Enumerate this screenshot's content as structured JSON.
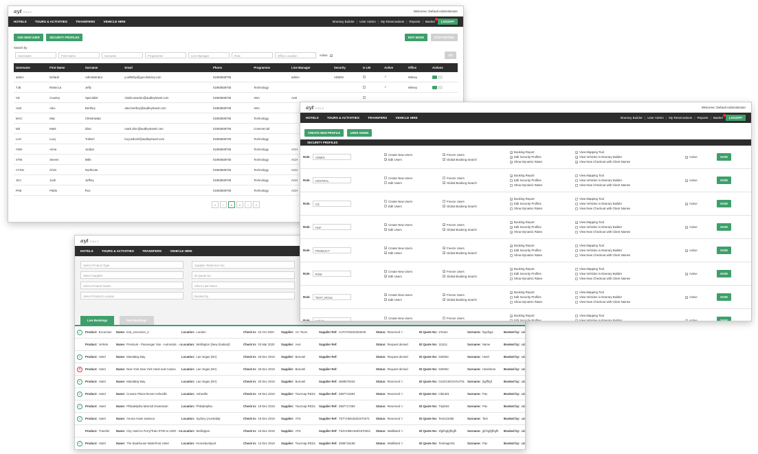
{
  "brand": {
    "logo": "ayt",
    "suffix": "GOLF"
  },
  "welcome": "Welcome: Default Administrator",
  "nav": {
    "left": [
      "HOTELS",
      "TOURS & ACTIVITIES",
      "TRANSFERS",
      "VEHICLE HIRE"
    ],
    "right": [
      "Itinerary Builder",
      "User Admin",
      "My Reservations",
      "Reports",
      "Basket"
    ],
    "logout": "LOGOFF"
  },
  "user_admin": {
    "buttons": {
      "add": "ADD NEW USER",
      "profiles": "SECURITY PROFILES",
      "edit": "EDIT MODE",
      "stop": "STOP EDITING"
    },
    "search_label": "Search by",
    "placeholders": [
      "Username",
      "First Name",
      "Surname",
      "Programme",
      "Line Manager",
      "Role",
      "Office Location"
    ],
    "active_label": "Active",
    "go": "GO",
    "columns": [
      "Username",
      "First Name",
      "Surname",
      "Email",
      "Phone",
      "Programme",
      "Line Manager",
      "Security",
      "Is LM",
      "Active",
      "Office",
      "Actions"
    ],
    "rows": [
      [
        "admin",
        "Default",
        "Administrator",
        "p.wilhitby@gocuhdsnry.com",
        "01993838705",
        "",
        "admin",
        "ADMIN",
        "",
        "✓",
        "Witney"
      ],
      [
        "TJE",
        "Rebecca",
        "Jeffy",
        "",
        "01993838705",
        "Technology",
        "",
        "",
        "",
        "✓",
        "Witney"
      ],
      [
        "CE",
        "Country",
        "Specialist",
        "claink.weedon@audleytravel.com",
        "01993838705",
        "ANA",
        "ALB",
        "",
        "",
        "",
        ""
      ],
      [
        "ALB",
        "Alex",
        "Berthey",
        "alex.berthey@audleytravel.com",
        "01993838705",
        "ANA",
        "",
        "",
        "",
        "",
        ""
      ],
      [
        "MAC",
        "Mac",
        "Chhetriwala",
        "",
        "01993838705",
        "Technology",
        "",
        "",
        "",
        "",
        ""
      ],
      [
        "MZ",
        "Mark",
        "Zilec",
        "mark.zilec@audleytravel.com",
        "01993838705",
        "Commercial",
        "",
        "",
        "",
        "",
        ""
      ],
      [
        "LUC",
        "Lucy",
        "Tulloch",
        "lucy.tulloch@audleytravel.com",
        "01993838705",
        "Technology",
        "",
        "",
        "",
        "",
        ""
      ],
      [
        "ANN",
        "Anna",
        "Jordan",
        "",
        "01993838705",
        "Technology",
        "ACH",
        "",
        "",
        "",
        ""
      ],
      [
        "STM",
        "Steven",
        "Mills",
        "",
        "01993838705",
        "Technology",
        "ACH",
        "",
        "",
        "",
        ""
      ],
      [
        "CTSN",
        "Chris",
        "Northcote",
        "",
        "01993838705",
        "Technology",
        "ACH",
        "",
        "",
        "",
        ""
      ],
      [
        "JOJ",
        "Josh",
        "Jeffrey",
        "",
        "01993838705",
        "Technology",
        "ACH",
        "",
        "",
        "",
        ""
      ],
      [
        "PAB",
        "Pablo",
        "Rox",
        "",
        "01993838705",
        "Technology",
        "ACH",
        "",
        "",
        "",
        ""
      ]
    ],
    "pages": [
      "«",
      "‹",
      "1",
      "2",
      "›",
      "»"
    ]
  },
  "security_profiles": {
    "buttons": {
      "create": "CREATE NEW PROFILE",
      "admin": "USER ADMIN"
    },
    "header": "SECURITY PROFILES",
    "role_label": "Role:",
    "save": "SAVE",
    "perm_labels": {
      "create_users": "Create New Users",
      "edit_users": "Edit Users",
      "freeze_users": "Freeze Users",
      "global_search": "Global Booking Search",
      "booking_report": "Booking Report",
      "edit_profiles": "Edit Security Profiles",
      "dynamic_rates": "Show Dynamic Rates",
      "mapping_tool": "View Mapping Tool",
      "vehicles": "View Vehicles in Itinerary Builder",
      "checkout": "View New Checkout with Client Names",
      "active": "Active"
    },
    "roles": [
      {
        "name": "ADMIN",
        "flags": [
          1,
          1,
          1,
          1,
          1,
          1,
          1,
          1,
          1,
          1,
          1
        ]
      },
      {
        "name": "CENTRAL",
        "flags": [
          0,
          0,
          0,
          1,
          1,
          0,
          0,
          0,
          0,
          0,
          1
        ]
      },
      {
        "name": "CS",
        "flags": [
          0,
          0,
          0,
          1,
          1,
          0,
          0,
          0,
          0,
          0,
          1
        ]
      },
      {
        "name": "HUF",
        "flags": [
          1,
          1,
          1,
          1,
          1,
          1,
          1,
          1,
          0,
          0,
          1
        ]
      },
      {
        "name": "PRODUCT",
        "flags": [
          1,
          1,
          1,
          1,
          1,
          0,
          0,
          0,
          0,
          0,
          1
        ]
      },
      {
        "name": "RSM",
        "flags": [
          1,
          1,
          1,
          1,
          1,
          0,
          0,
          0,
          0,
          0,
          1
        ]
      },
      {
        "name": "TEST_ROLE",
        "flags": [
          1,
          1,
          1,
          1,
          1,
          0,
          0,
          0,
          0,
          0,
          1
        ]
      },
      {
        "name": "Vehicle",
        "flags": [
          0,
          0,
          0,
          1,
          1,
          0,
          0,
          0,
          1,
          0,
          1
        ]
      }
    ]
  },
  "bookings": {
    "filters": [
      "Select Product Type",
      "Supplier Reference No",
      "Select Supplier",
      "ID Quote No",
      "Select Product Name",
      "Client Last Name",
      "Select Product Location",
      "Booked by"
    ],
    "tabs": [
      "Live Bookings",
      "Past Bookings"
    ],
    "labels": {
      "product": "Product:",
      "name": "Name:",
      "location": "Location:",
      "checkin": "Check In:",
      "supplier": "Supplier:",
      "supref": "Supplier Ref:",
      "status": "Status:",
      "idquote": "ID Quote No:",
      "surname": "Surname:",
      "bookedby": "Booked by:"
    },
    "rows": [
      {
        "state": "ok",
        "product": "Excursion",
        "name": "test_excursion_2",
        "location": "London",
        "checkin": "23 Oct 2020",
        "supplier": "AC Tours",
        "supref": "AUT2725SS/263248",
        "status": "Reserved",
        "idquote": "2Years",
        "surname": "fsgsfsgs",
        "bookedby": "admin"
      },
      {
        "state": "none",
        "product": "Vehicle",
        "name": "Premium - Passenger Van - Automatic - A/C (PVAR)",
        "location": "Wellington (New Zealand)",
        "checkin": "03 Mar 2020",
        "supplier": "Avis",
        "supref": "",
        "status": "Request denied",
        "idquote": "111111",
        "surname": "Name",
        "bookedby": "admin"
      },
      {
        "state": "ok",
        "product": "Hotel",
        "name": "Mandalay Bay",
        "location": "Las Vegas (NV)",
        "checkin": "26 Dec 2019",
        "supplier": "Bonotel",
        "supref": "",
        "status": "Request denied",
        "idquote": "529363",
        "surname": "Hotel",
        "bookedby": "admin"
      },
      {
        "state": "bad",
        "product": "Hotel",
        "name": "New York New York Hotel and Casino",
        "location": "Las Vegas (NV)",
        "checkin": "26 Dec 2019",
        "supplier": "Bonotel",
        "supref": "",
        "status": "Request denied",
        "idquote": "529363",
        "surname": "Hotelstore",
        "bookedby": "admin"
      },
      {
        "state": "ok",
        "product": "Hotel",
        "name": "Mandalay Bay",
        "location": "Las Vegas (NV)",
        "checkin": "20 Dec 2019",
        "supplier": "Bonotel",
        "supref": "4658576234",
        "status": "Reserved",
        "idquote": "OLDCHECKOUT01",
        "surname": "jhgffhgf",
        "bookedby": "admin"
      },
      {
        "state": "ok",
        "product": "Hotel",
        "name": "Crowne Plaza Resort Asheville",
        "location": "Asheville",
        "checkin": "19 Dec 2019",
        "supplier": "Tourmap RED1",
        "supref": "3387713294",
        "status": "Reserved",
        "idquote": "Infant01",
        "surname": "Pax",
        "bookedby": "admin"
      },
      {
        "state": "ok",
        "product": "Hotel",
        "name": "Philadelphia Marriott Downtown",
        "location": "Philadelphia",
        "checkin": "19 Dec 2019",
        "supplier": "Tourmap RED1",
        "supref": "3387717293",
        "status": "Reserved",
        "idquote": "Triple02",
        "surname": "Pax",
        "bookedby": "admin"
      },
      {
        "state": "ok",
        "product": "Hotel",
        "name": "Amora Hotel Jamison",
        "location": "Sydney (Australia)",
        "checkin": "19 Dec 2019",
        "supplier": "ATS",
        "supref": "TSTYHM4453/1570271",
        "status": "Reserved",
        "idquote": "Test123456",
        "surname": "Test",
        "bookedby": "admin"
      },
      {
        "state": "none",
        "product": "Transfer",
        "name": "City Hotel to Ferry/Train 0700 to 2200 - Sedan 1-2pax",
        "location": "Wellington",
        "checkin": "16 Dec 2019",
        "supplier": "ATS",
        "supref": "TSZAHMH4S9/1570261",
        "status": "Waitlisted",
        "idquote": "sfghhgfgfhgfh",
        "surname": "gfchgfgfhgfh",
        "bookedby": "admin"
      },
      {
        "state": "ok",
        "product": "Hotel",
        "name": "The Boathouse Waterfront Hotel",
        "location": "Kennebunkport",
        "checkin": "12 Dec 2019",
        "supplier": "Tourmap RED1",
        "supref": "3388715199",
        "status": "Waitlisted",
        "idquote": "Testnager01",
        "surname": "Pax",
        "bookedby": "admin"
      }
    ]
  }
}
